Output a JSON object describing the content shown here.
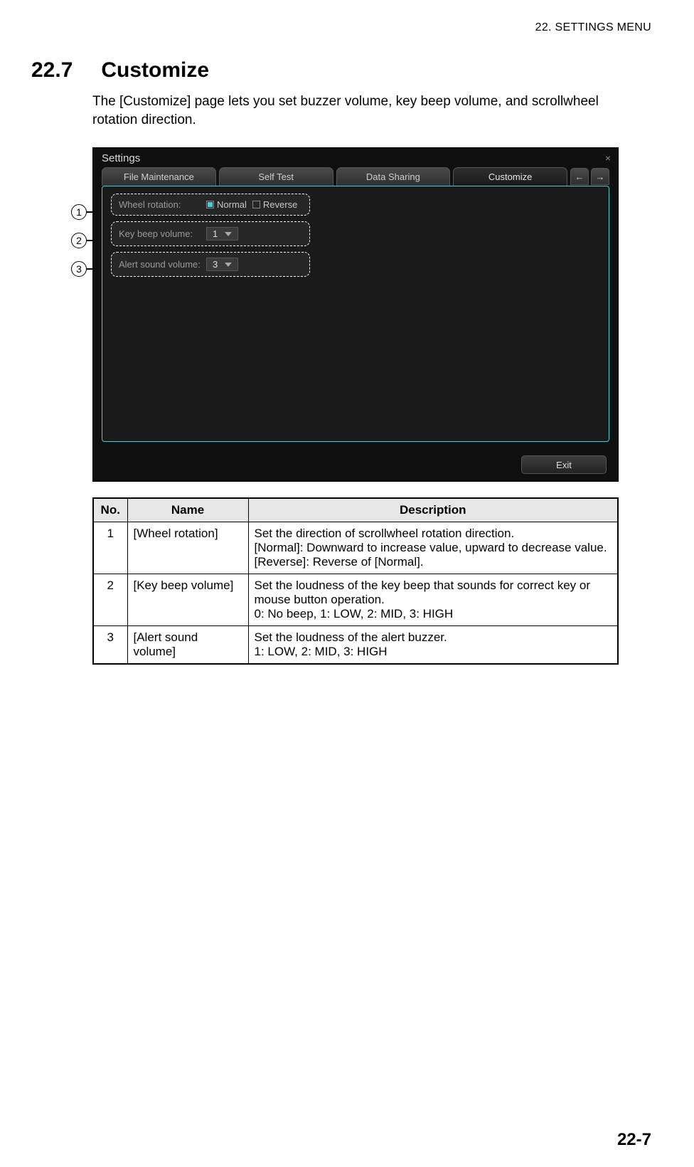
{
  "header": {
    "running_head": "22.  SETTINGS MENU",
    "section_number": "22.7",
    "section_title": "Customize",
    "intro": "The [Customize] page lets you set buzzer volume, key beep volume, and scrollwheel rotation direction."
  },
  "screenshot": {
    "window_title": "Settings",
    "close_glyph": "×",
    "tabs": [
      "File Maintenance",
      "Self Test",
      "Data Sharing",
      "Customize"
    ],
    "arrow_left": "←",
    "arrow_right": "→",
    "controls": {
      "wheel_rotation": {
        "label": "Wheel rotation:",
        "option_normal": "Normal",
        "option_reverse": "Reverse"
      },
      "key_beep": {
        "label": "Key beep volume:",
        "value": "1"
      },
      "alert_sound": {
        "label": "Alert sound volume:",
        "value": "3"
      }
    },
    "exit_label": "Exit"
  },
  "callouts": {
    "c1": "1",
    "c2": "2",
    "c3": "3"
  },
  "table": {
    "head": {
      "no": "No.",
      "name": "Name",
      "desc": "Description"
    },
    "rows": [
      {
        "no": "1",
        "name": "[Wheel rotation]",
        "desc": "Set the direction of scrollwheel rotation direction.\n[Normal]: Downward to increase value, upward to decrease value.\n[Reverse]: Reverse of [Normal]."
      },
      {
        "no": "2",
        "name": "[Key beep volume]",
        "desc": "Set the loudness of the key beep that sounds for correct key or mouse button operation.\n0: No beep, 1: LOW, 2: MID, 3: HIGH"
      },
      {
        "no": "3",
        "name": "[Alert sound volume]",
        "desc": "Set the loudness of the alert buzzer.\n1: LOW, 2: MID, 3: HIGH"
      }
    ]
  },
  "footer": {
    "page_number": "22-7"
  }
}
